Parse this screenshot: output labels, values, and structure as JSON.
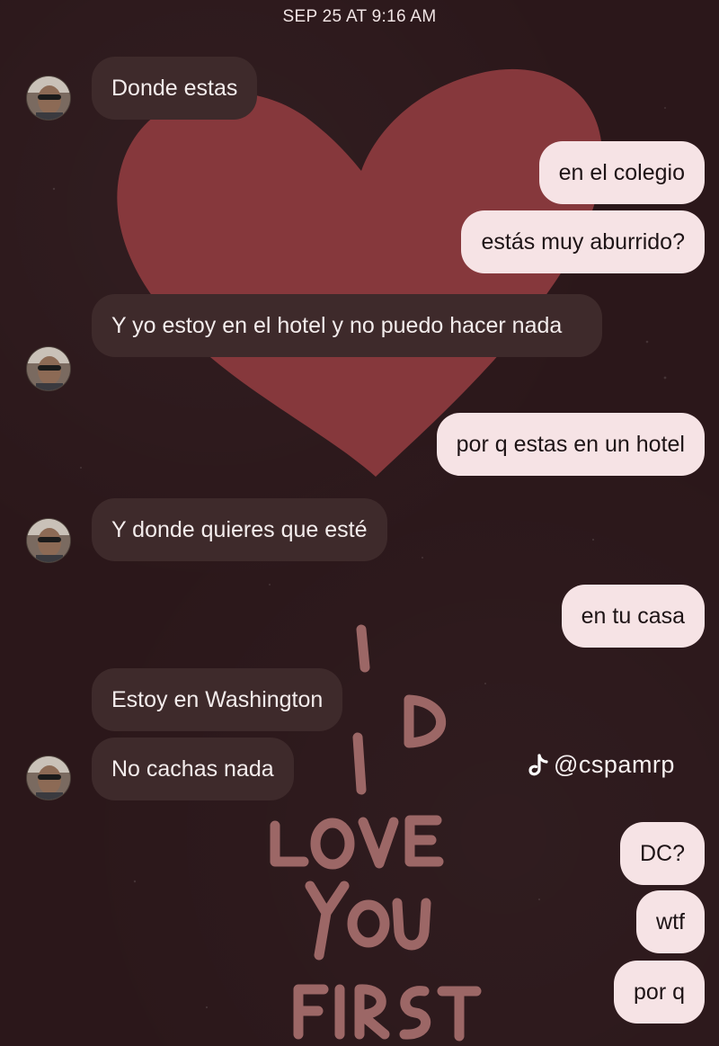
{
  "timestamp": "SEP 25 AT 9:16 AM",
  "wallpaper": {
    "art_text_lines": [
      "I",
      "SAID",
      "I",
      "LOVE",
      "YOU",
      "FIRST"
    ],
    "heart_color": "#8e3b3f",
    "text_color": "#a86f6e"
  },
  "messages": [
    {
      "from": "them",
      "text": "Donde estas"
    },
    {
      "from": "me",
      "text": "en el colegio"
    },
    {
      "from": "me",
      "text": "estás muy aburrido?"
    },
    {
      "from": "them",
      "text": "Y yo estoy en el hotel y no puedo hacer nada"
    },
    {
      "from": "me",
      "text": "por q estas en un hotel"
    },
    {
      "from": "them",
      "text": "Y donde quieres que esté"
    },
    {
      "from": "me",
      "text": "en tu casa"
    },
    {
      "from": "them",
      "text": "Estoy en Washington"
    },
    {
      "from": "them",
      "text": "No cachas nada"
    },
    {
      "from": "me",
      "text": "DC?"
    },
    {
      "from": "me",
      "text": "wtf"
    },
    {
      "from": "me",
      "text": "por q"
    }
  ],
  "watermark": {
    "icon": "tiktok-icon",
    "handle": "@cspamrp"
  },
  "colors": {
    "incoming_bubble": "#3e2a2b",
    "outgoing_bubble": "#f6e3e5",
    "background": "#2b171a"
  }
}
